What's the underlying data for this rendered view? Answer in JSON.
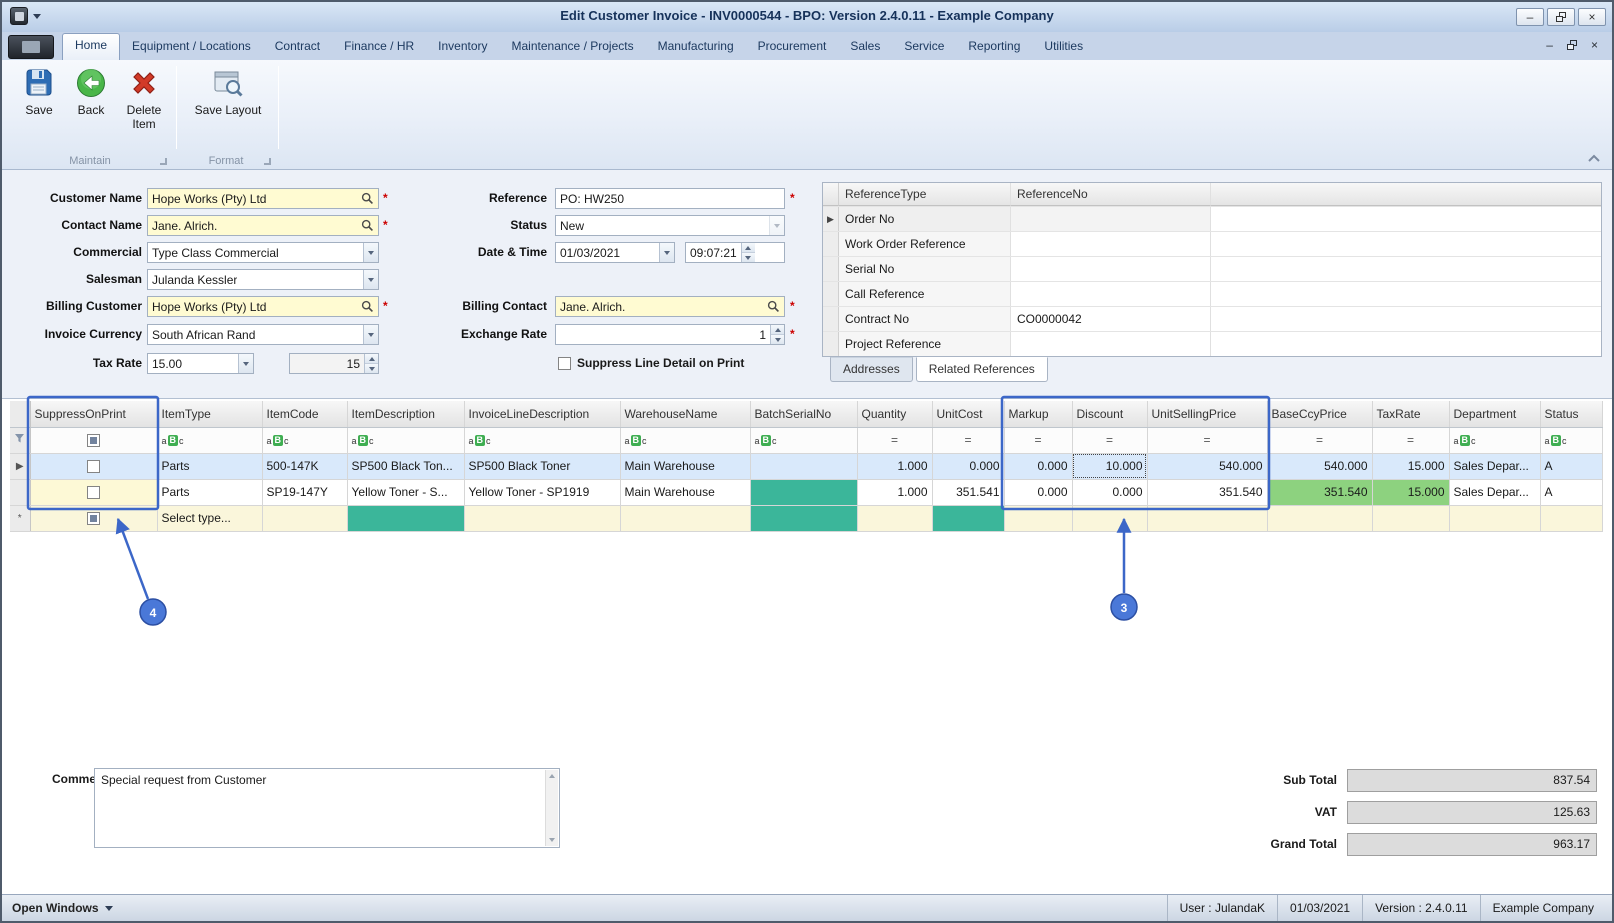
{
  "window": {
    "title": "Edit Customer Invoice - INV0000544 - BPO: Version 2.4.0.11 - Example Company"
  },
  "ribbon": {
    "tabs": [
      "Home",
      "Equipment / Locations",
      "Contract",
      "Finance / HR",
      "Inventory",
      "Maintenance / Projects",
      "Manufacturing",
      "Procurement",
      "Sales",
      "Service",
      "Reporting",
      "Utilities"
    ],
    "buttons": {
      "save": "Save",
      "back": "Back",
      "delete_item": "Delete Item",
      "save_layout": "Save Layout"
    },
    "groups": {
      "maintain": "Maintain",
      "format": "Format"
    }
  },
  "form": {
    "customer_name": {
      "label": "Customer Name",
      "value": "Hope Works (Pty) Ltd"
    },
    "contact_name": {
      "label": "Contact Name",
      "value": "Jane. Alrich."
    },
    "commercial": {
      "label": "Commercial",
      "value": "Type Class Commercial"
    },
    "salesman": {
      "label": "Salesman",
      "value": "Julanda Kessler"
    },
    "billing_customer": {
      "label": "Billing Customer",
      "value": "Hope Works (Pty) Ltd"
    },
    "invoice_currency": {
      "label": "Invoice Currency",
      "value": "South African Rand"
    },
    "tax_rate": {
      "label": "Tax Rate",
      "value": "15.00",
      "value2": "15"
    },
    "reference": {
      "label": "Reference",
      "value": "PO: HW250"
    },
    "status": {
      "label": "Status",
      "value": "New"
    },
    "date_time": {
      "label": "Date & Time",
      "date": "01/03/2021",
      "time": "09:07:21"
    },
    "billing_contact": {
      "label": "Billing Contact",
      "value": "Jane. Alrich."
    },
    "exchange_rate": {
      "label": "Exchange Rate",
      "value": "1"
    },
    "suppress_line_detail": {
      "label": "Suppress Line Detail on Print"
    }
  },
  "references": {
    "columns": {
      "type": "ReferenceType",
      "no": "ReferenceNo"
    },
    "rows": [
      {
        "type": "Order No",
        "no": ""
      },
      {
        "type": "Work Order Reference",
        "no": ""
      },
      {
        "type": "Serial No",
        "no": ""
      },
      {
        "type": "Call Reference",
        "no": ""
      },
      {
        "type": "Contract No",
        "no": "CO0000042"
      },
      {
        "type": "Project Reference",
        "no": ""
      }
    ],
    "tabs": {
      "addresses": "Addresses",
      "related_references": "Related References"
    }
  },
  "grid": {
    "columns": [
      "SuppressOnPrint",
      "ItemType",
      "ItemCode",
      "ItemDescription",
      "InvoiceLineDescription",
      "WarehouseName",
      "BatchSerialNo",
      "Quantity",
      "UnitCost",
      "Markup",
      "Discount",
      "UnitSellingPrice",
      "BaseCcyPrice",
      "TaxRate",
      "Department",
      "Status"
    ],
    "rows": [
      {
        "ItemType": "Parts",
        "ItemCode": "500-147K",
        "ItemDescription": "SP500 Black Ton...",
        "InvoiceLineDescription": "SP500 Black Toner",
        "WarehouseName": "Main Warehouse",
        "BatchSerialNo": "",
        "Quantity": "1.000",
        "UnitCost": "0.000",
        "Markup": "0.000",
        "Discount": "10.000",
        "UnitSellingPrice": "540.000",
        "BaseCcyPrice": "540.000",
        "TaxRate": "15.000",
        "Department": "Sales Depar...",
        "Status": "A"
      },
      {
        "ItemType": "Parts",
        "ItemCode": "SP19-147Y",
        "ItemDescription": "Yellow Toner - S...",
        "InvoiceLineDescription": "Yellow Toner - SP1919",
        "WarehouseName": "Main Warehouse",
        "BatchSerialNo": "",
        "Quantity": "1.000",
        "UnitCost": "351.541",
        "Markup": "0.000",
        "Discount": "0.000",
        "UnitSellingPrice": "351.540",
        "BaseCcyPrice": "351.540",
        "TaxRate": "15.000",
        "Department": "Sales Depar...",
        "Status": "A"
      }
    ],
    "new_row": {
      "ItemType": "Select type..."
    }
  },
  "comment": {
    "label": "Comment",
    "value": "Special request from Customer"
  },
  "totals": {
    "sub_total_label": "Sub Total",
    "sub_total": "837.54",
    "vat_label": "VAT",
    "vat": "125.63",
    "grand_total_label": "Grand Total",
    "grand_total": "963.17"
  },
  "statusbar": {
    "open_windows": "Open Windows",
    "user": "User : JulandaK",
    "date": "01/03/2021",
    "version": "Version : 2.4.0.11",
    "company": "Example Company"
  },
  "annotations": {
    "badge_3": "3",
    "badge_4": "4"
  },
  "icons": {
    "required": "*",
    "current_row": "▶",
    "new_row": "*",
    "filter_equals": "=",
    "minimize": "–",
    "close": "×"
  },
  "colors": {
    "annotation_blue": "#3c67c8",
    "cell_green": "#8dd27f",
    "cell_teal": "#3bb69a",
    "field_yellow": "#fffbd2",
    "selected_row": "#d9e9fb"
  }
}
